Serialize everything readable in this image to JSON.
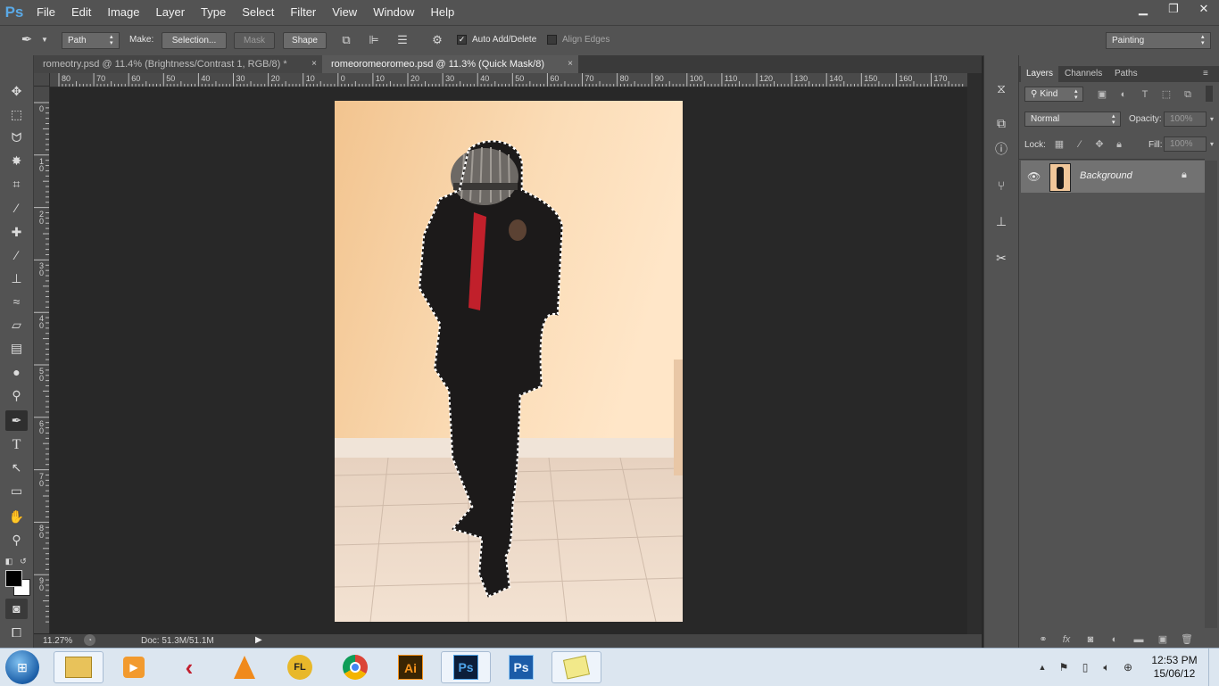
{
  "app": {
    "logo": "Ps"
  },
  "menu": [
    "File",
    "Edit",
    "Image",
    "Layer",
    "Type",
    "Select",
    "Filter",
    "View",
    "Window",
    "Help"
  ],
  "window_controls": {
    "minimize": "▁",
    "restore": "❐",
    "close": "✕"
  },
  "options_bar": {
    "tool_mode": "Path",
    "make_label": "Make:",
    "selection_button": "Selection...",
    "mask_button": "Mask",
    "shape_button": "Shape",
    "auto_add_delete": "Auto Add/Delete",
    "auto_add_delete_checked": true,
    "align_edges": "Align Edges",
    "align_edges_checked": false,
    "workspace": "Painting"
  },
  "tabs": [
    {
      "label": "romeotry.psd @ 11.4% (Brightness/Contrast 1, RGB/8) *",
      "close": "×",
      "active": false
    },
    {
      "label": "romeoromeoromeo.psd @ 11.3% (Quick Mask/8)",
      "close": "×",
      "active": true
    }
  ],
  "ruler_h_labels": [
    "80",
    "70",
    "60",
    "50",
    "40",
    "30",
    "20",
    "10",
    "0",
    "10",
    "20",
    "30",
    "40",
    "50",
    "60",
    "70",
    "80",
    "90",
    "100",
    "110",
    "120",
    "130",
    "140",
    "150",
    "160",
    "170"
  ],
  "ruler_v_labels": [
    "0",
    "10",
    "20",
    "30",
    "40",
    "50",
    "60",
    "70",
    "80",
    "90"
  ],
  "status": {
    "zoom": "11.27%",
    "doc": "Doc: 51.3M/51.1M"
  },
  "layers_panel": {
    "tabs": [
      "Layers",
      "Channels",
      "Paths"
    ],
    "kind_filter": "Kind",
    "blend_mode": "Normal",
    "opacity_label": "Opacity:",
    "opacity_value": "100%",
    "lock_label": "Lock:",
    "fill_label": "Fill:",
    "fill_value": "100%",
    "layers": [
      {
        "name": "Background",
        "visible": true,
        "locked": true
      }
    ]
  },
  "taskbar": {
    "time": "12:53 PM",
    "date": "15/06/12",
    "apps": [
      "explorer",
      "media-player",
      "flashget",
      "vlc",
      "fl-studio",
      "chrome",
      "illustrator",
      "photoshop",
      "photoshop-2",
      "sticky-notes"
    ],
    "ai_label": "Ai",
    "ps_label": "Ps"
  },
  "colors": {
    "accent": "#5aa9e6",
    "panel": "#535353",
    "canvas": "#282828"
  }
}
